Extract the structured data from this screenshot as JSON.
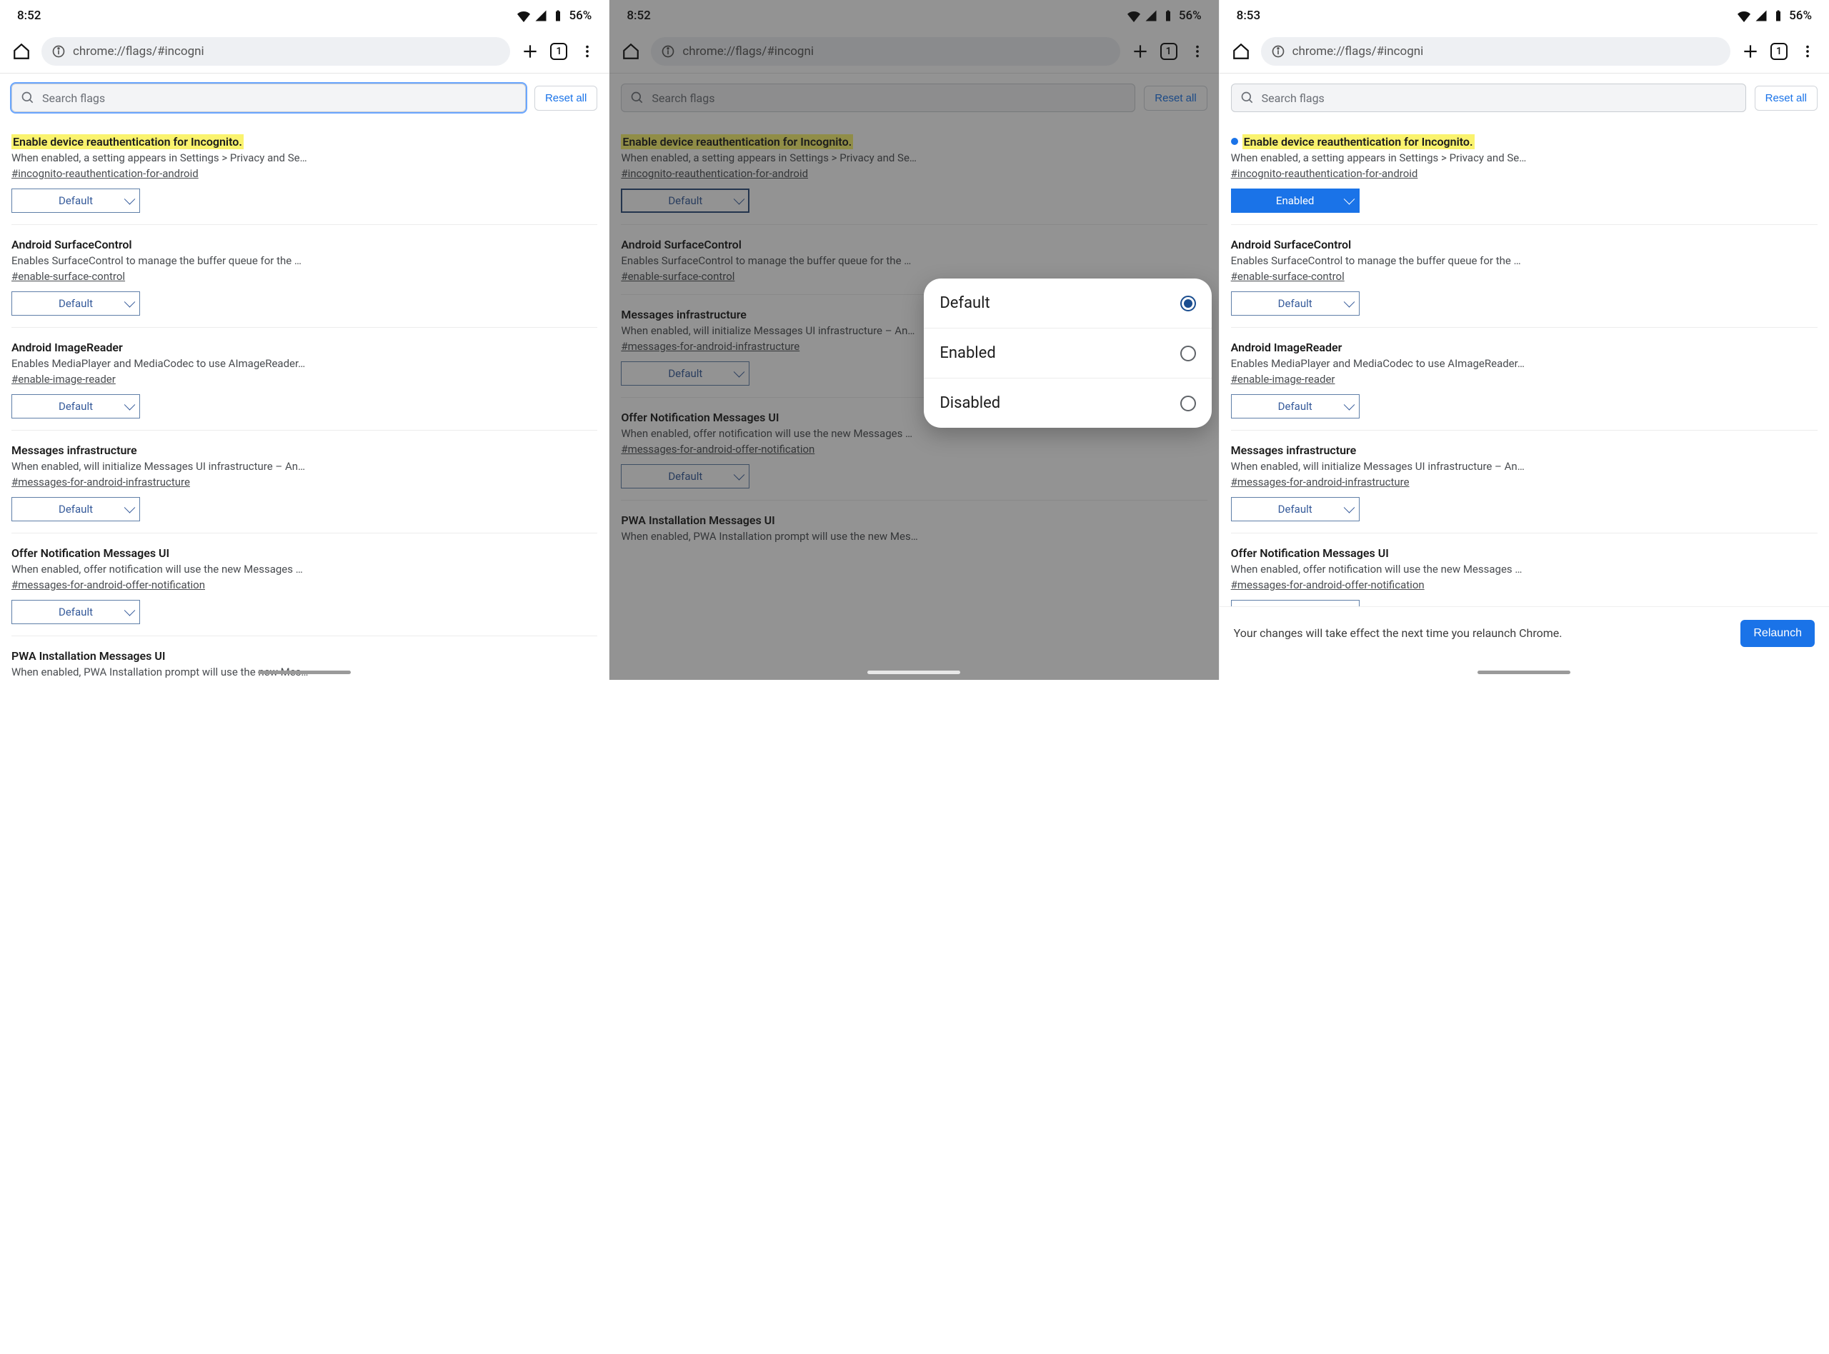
{
  "status": {
    "t1": "8:52",
    "t2": "8:52",
    "t3": "8:53",
    "battery": "56%"
  },
  "omnibox": {
    "url": "chrome://flags/#incogni",
    "tab_count": "1"
  },
  "toolbar": {
    "search_placeholder": "Search flags",
    "reset": "Reset all"
  },
  "sheet": {
    "o1": "Default",
    "o2": "Enabled",
    "o3": "Disabled"
  },
  "snackbar": {
    "text": "Your changes will take effect the next time you relaunch Chrome.",
    "btn": "Relaunch"
  },
  "values": {
    "default": "Default",
    "enabled": "Enabled"
  },
  "flags": [
    {
      "title": "Enable device reauthentication for Incognito.",
      "desc": "When enabled, a setting appears in Settings > Privacy and Se…",
      "hash": "#incognito-reauthentication-for-android"
    },
    {
      "title": "Android SurfaceControl",
      "desc": "Enables SurfaceControl to manage the buffer queue for the …",
      "hash": "#enable-surface-control"
    },
    {
      "title": "Android ImageReader",
      "desc": "Enables MediaPlayer and MediaCodec to use AImageReader…",
      "hash": "#enable-image-reader"
    },
    {
      "title": "Messages infrastructure",
      "desc": "When enabled, will initialize Messages UI infrastructure – An…",
      "hash": "#messages-for-android-infrastructure"
    },
    {
      "title": "Offer Notification Messages UI",
      "desc": "When enabled, offer notification will use the new Messages …",
      "hash": "#messages-for-android-offer-notification"
    },
    {
      "title": "PWA Installation Messages UI",
      "desc": "When enabled, PWA Installation prompt will use the new Mes…",
      "hash": ""
    }
  ]
}
